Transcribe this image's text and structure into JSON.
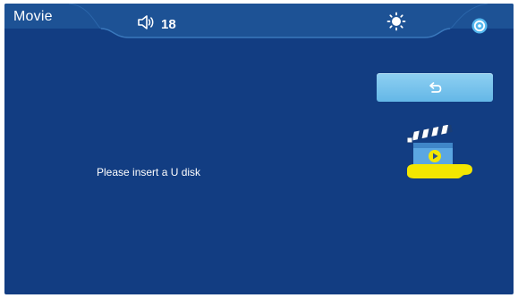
{
  "header": {
    "title": "Movie",
    "volume_level": "18",
    "volume_icon": "speaker-icon",
    "brightness_icon": "sun-icon",
    "settings_icon": "settings-icon"
  },
  "toolbar": {
    "back_icon": "return-arrow-icon"
  },
  "main": {
    "message": "Please insert a U disk",
    "illustration": "movie-clapperboard-icon"
  },
  "colors": {
    "background": "#123d82",
    "status_bar": "#1e5296",
    "button": "#7cc4ee",
    "accent_yellow": "#f3e600"
  }
}
